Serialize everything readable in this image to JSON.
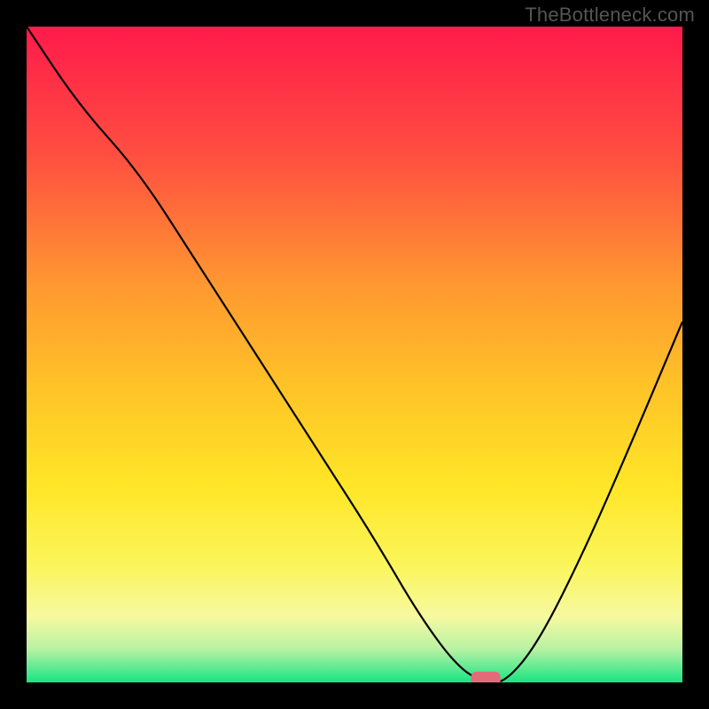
{
  "watermark": "TheBottleneck.com",
  "chart_data": {
    "type": "line",
    "title": "",
    "xlabel": "",
    "ylabel": "",
    "xlim": [
      0,
      100
    ],
    "ylim": [
      0,
      100
    ],
    "grid": false,
    "legend": false,
    "background_gradient": {
      "stops": [
        {
          "offset": 0.0,
          "color": "#ff1a4b"
        },
        {
          "offset": 0.2,
          "color": "#ff5040"
        },
        {
          "offset": 0.4,
          "color": "#ff9a30"
        },
        {
          "offset": 0.55,
          "color": "#ffc327"
        },
        {
          "offset": 0.7,
          "color": "#ffe627"
        },
        {
          "offset": 0.82,
          "color": "#fbf55a"
        },
        {
          "offset": 0.9,
          "color": "#f6f9a0"
        },
        {
          "offset": 0.95,
          "color": "#b6f2a3"
        },
        {
          "offset": 1.0,
          "color": "#19e484"
        }
      ]
    },
    "series": [
      {
        "name": "bottleneck-curve",
        "color": "#000000",
        "stroke_width": 2.2,
        "x": [
          0,
          8,
          17,
          26,
          35,
          44,
          53,
          60,
          66,
          70,
          73,
          78,
          85,
          92,
          100
        ],
        "y": [
          100,
          88,
          78,
          64,
          50,
          36,
          22,
          10,
          2,
          0,
          0,
          6,
          20,
          36,
          55
        ]
      }
    ],
    "marker": {
      "name": "trough-marker",
      "x": 70,
      "y": 0,
      "width_pct": 4.5,
      "height_pct": 2.2,
      "color": "#e46a7a"
    }
  }
}
